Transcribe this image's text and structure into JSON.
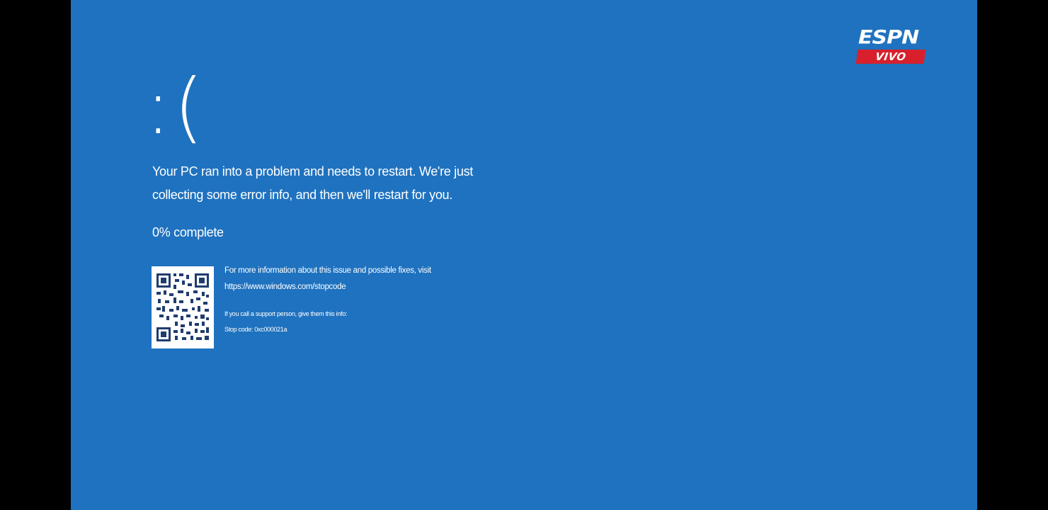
{
  "bsod": {
    "emoticon": ":(",
    "message": "Your PC ran into a problem and needs to restart. We're just collecting some error info, and then we'll restart for you.",
    "progress_text": "0% complete",
    "progress_percent": 0,
    "info_line": "For more information about this issue and possible fixes, visit",
    "info_url": "https://www.windows.com/stopcode",
    "support_line": "If you call a support person, give them this info:",
    "stop_code": "Stop code: 0xc000021a"
  },
  "overlay": {
    "logo_top": "ESPN",
    "logo_bottom": "VIVO"
  },
  "colors": {
    "background": "#1f72bf",
    "letterbox": "#000000",
    "text": "#ffffff",
    "logo_red": "#d7202c"
  },
  "icons": {
    "qr_code": "qr-code-icon"
  }
}
